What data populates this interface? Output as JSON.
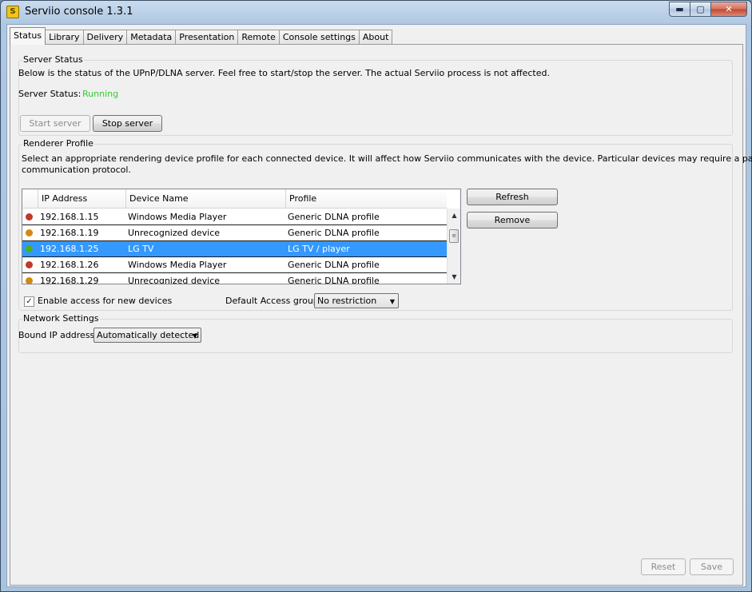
{
  "window": {
    "title": "Serviio console 1.3.1",
    "min_glyph": "▬",
    "max_glyph": "▢",
    "close_glyph": "✕"
  },
  "tabs": [
    "Status",
    "Library",
    "Delivery",
    "Metadata",
    "Presentation",
    "Remote",
    "Console settings",
    "About"
  ],
  "server_status": {
    "group_title": "Server Status",
    "description": "Below is the status of the UPnP/DLNA server. Feel free to start/stop the server. The actual Serviio process is not affected.",
    "label": "Server Status:",
    "value": "Running",
    "value_color": "#33cc33",
    "start_button": "Start server",
    "stop_button": "Stop server"
  },
  "renderer_profile": {
    "group_title": "Renderer Profile",
    "description_line1": "Select an appropriate rendering device profile for each connected device. It will affect how Serviio communicates with the device. Particular devices may require a particular",
    "description_line2": "communication protocol.",
    "columns": [
      "",
      "IP Address",
      "Device Name",
      "Profile"
    ],
    "rows": [
      {
        "status_color": "#c0392b",
        "ip": "192.168.1.15",
        "device": "Windows Media Player",
        "profile": "Generic DLNA profile",
        "selected": false
      },
      {
        "status_color": "#d4880f",
        "ip": "192.168.1.19",
        "device": "Unrecognized device",
        "profile": "Generic DLNA profile",
        "selected": false
      },
      {
        "status_color": "#4caf1e",
        "ip": "192.168.1.25",
        "device": "LG TV",
        "profile": "LG TV / player",
        "selected": true
      },
      {
        "status_color": "#c0392b",
        "ip": "192.168.1.26",
        "device": "Windows Media Player",
        "profile": "Generic DLNA profile",
        "selected": false
      },
      {
        "status_color": "#d4880f",
        "ip": "192.168.1.29",
        "device": "Unrecognized device",
        "profile": "Generic DLNA profile",
        "selected": false
      }
    ],
    "refresh_button": "Refresh",
    "remove_button": "Remove",
    "enable_access_label": "Enable access for new devices",
    "enable_access_checked": true,
    "default_group_label": "Default Access group:",
    "default_group_value": "No restriction"
  },
  "network_settings": {
    "group_title": "Network Settings",
    "bound_ip_label": "Bound IP address:",
    "bound_ip_value": "Automatically detected"
  },
  "footer": {
    "reset_button": "Reset",
    "save_button": "Save"
  }
}
